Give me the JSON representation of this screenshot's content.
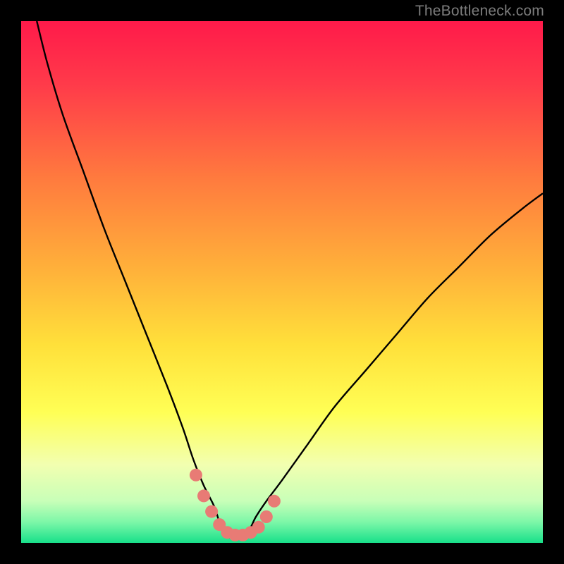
{
  "watermark": "TheBottleneck.com",
  "colors": {
    "black": "#000000",
    "watermark": "#7c7c7c",
    "curve": "#000000",
    "marker": "#e87b75",
    "gradient_stops": [
      {
        "offset": 0.0,
        "color": "#ff1a4a"
      },
      {
        "offset": 0.12,
        "color": "#ff3a4a"
      },
      {
        "offset": 0.3,
        "color": "#ff7a3e"
      },
      {
        "offset": 0.48,
        "color": "#ffb23a"
      },
      {
        "offset": 0.62,
        "color": "#ffe03a"
      },
      {
        "offset": 0.75,
        "color": "#ffff55"
      },
      {
        "offset": 0.85,
        "color": "#f2ffb0"
      },
      {
        "offset": 0.92,
        "color": "#c8ffb8"
      },
      {
        "offset": 0.96,
        "color": "#7df7a8"
      },
      {
        "offset": 1.0,
        "color": "#18e08a"
      }
    ]
  },
  "chart_data": {
    "type": "line",
    "title": "",
    "xlabel": "",
    "ylabel": "",
    "xlim": [
      0,
      100
    ],
    "ylim": [
      0,
      100
    ],
    "grid": false,
    "series": [
      {
        "name": "bottleneck-curve",
        "note": "y is bottleneck % (0=green bottom, 100=red top); x is relative hardware balance axis",
        "x": [
          3,
          5,
          8,
          12,
          16,
          20,
          24,
          28,
          31,
          33,
          35,
          37,
          38,
          39,
          40,
          41,
          42,
          43,
          44,
          45,
          47,
          50,
          55,
          60,
          66,
          72,
          78,
          84,
          90,
          96,
          100
        ],
        "values": [
          100,
          92,
          82,
          71,
          60,
          50,
          40,
          30,
          22,
          16,
          11,
          7,
          4,
          2,
          1,
          1,
          1,
          2,
          3,
          5,
          8,
          12,
          19,
          26,
          33,
          40,
          47,
          53,
          59,
          64,
          67
        ]
      }
    ],
    "markers": {
      "name": "optimal-range-dots",
      "color": "#e87b75",
      "x": [
        33.5,
        35,
        36.5,
        38,
        39.5,
        41,
        42.5,
        44,
        45.5,
        47,
        48.5
      ],
      "values": [
        13,
        9,
        6,
        3.5,
        2,
        1.5,
        1.5,
        2,
        3,
        5,
        8
      ]
    }
  }
}
